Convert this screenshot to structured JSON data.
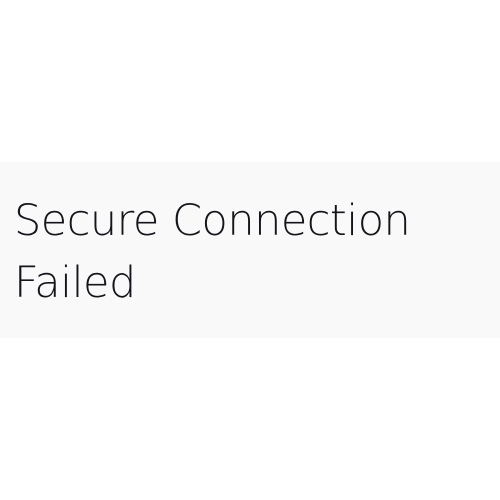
{
  "error_page": {
    "title": "Secure Connection Failed",
    "background_color": "#f9f9fa",
    "text_color": "#15141a"
  }
}
